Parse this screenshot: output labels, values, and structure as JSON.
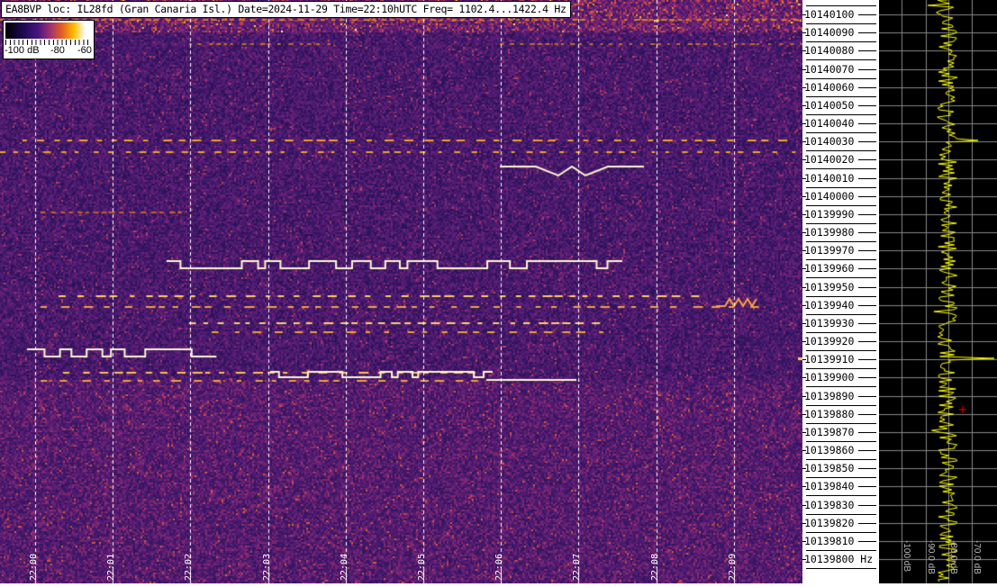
{
  "title": "EA8BVP loc: IL28fd (Gran Canaria Isl.) Date=2024-11-29 Time=22:10hUTC Freq= 1102.4...1422.4 Hz",
  "colorbar": {
    "labels": [
      "-100 dB",
      "-80",
      "-60"
    ],
    "range_db": [
      -100,
      -60
    ]
  },
  "time_labels": [
    "22:00",
    "22:01",
    "22:02",
    "22:03",
    "22:04",
    "22:05",
    "22:06",
    "22:07",
    "22:08",
    "22:09"
  ],
  "freq_labels": [
    "10140100",
    "10140090",
    "10140080",
    "10140070",
    "10140060",
    "10140050",
    "10140040",
    "10140030",
    "10140020",
    "10140010",
    "10140000",
    "10139990",
    "10139980",
    "10139970",
    "10139960",
    "10139950",
    "10139940",
    "10139930",
    "10139920",
    "10139910",
    "10139900",
    "10139890",
    "10139880",
    "10139870",
    "10139860",
    "10139850",
    "10139840",
    "10139830",
    "10139820",
    "10139810",
    "10139800 Hz"
  ],
  "spectrum_labels": [
    "-100 dB",
    "-90.0 dB",
    "-80.0 dB",
    "-70.0 dB"
  ],
  "colors": {
    "trace": "#ffff00",
    "background": "#000000",
    "marker": "#ff0000"
  }
}
